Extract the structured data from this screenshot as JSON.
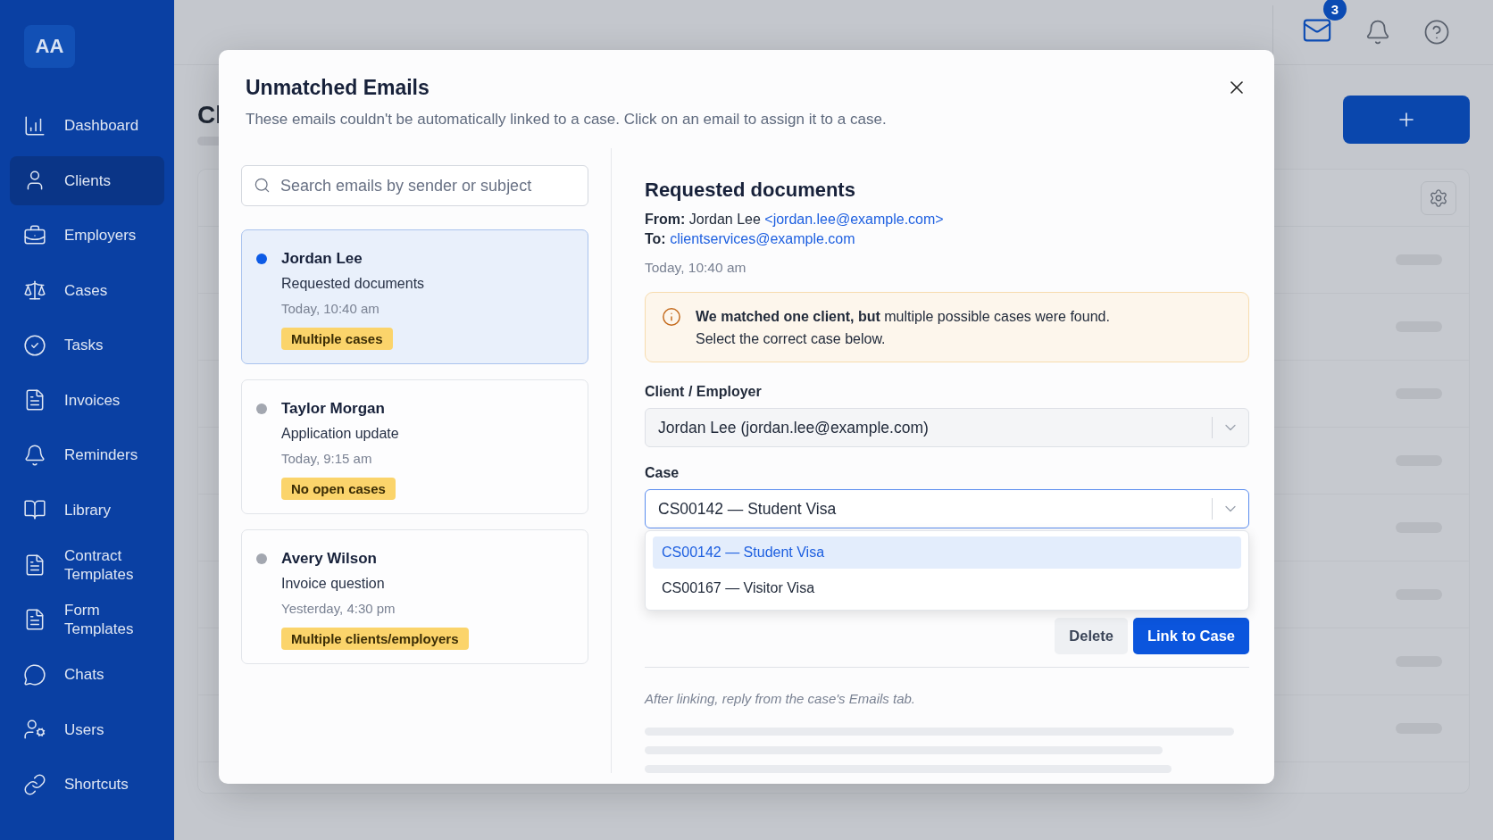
{
  "sidebar": {
    "logo": "AA",
    "items": [
      {
        "label": "Dashboard",
        "selected": false
      },
      {
        "label": "Clients",
        "selected": true
      },
      {
        "label": "Employers",
        "selected": false
      },
      {
        "label": "Cases",
        "selected": false
      },
      {
        "label": "Tasks",
        "selected": false
      },
      {
        "label": "Invoices",
        "selected": false
      },
      {
        "label": "Reminders",
        "selected": false
      },
      {
        "label": "Library",
        "selected": false
      },
      {
        "label": "Contract Templates",
        "selected": false
      },
      {
        "label": "Form Templates",
        "selected": false
      },
      {
        "label": "Chats",
        "selected": false
      },
      {
        "label": "Users",
        "selected": false
      },
      {
        "label": "Shortcuts",
        "selected": false
      }
    ]
  },
  "topbar": {
    "mail_badge": "3"
  },
  "page": {
    "title": "Cl"
  },
  "modal": {
    "title": "Unmatched Emails",
    "subtitle": "These emails couldn't be automatically linked to a case. Click on an email to assign it to a case.",
    "search": {
      "placeholder": "Search emails by sender or subject"
    },
    "emails": [
      {
        "sender": "Jordan Lee",
        "subject": "Requested documents",
        "time": "Today, 10:40 am",
        "tag": "Multiple cases",
        "selected": true
      },
      {
        "sender": "Taylor Morgan",
        "subject": "Application update",
        "time": "Today, 9:15 am",
        "tag": "No open cases",
        "selected": false
      },
      {
        "sender": "Avery Wilson",
        "subject": "Invoice question",
        "time": "Yesterday, 4:30 pm",
        "tag": "Multiple clients/employers",
        "selected": false
      }
    ],
    "detail": {
      "subject": "Requested documents",
      "from_label": "From:",
      "from_name": "Jordan Lee",
      "from_email": "<jordan.lee@example.com>",
      "to_label": "To:",
      "to_email": "clientservices@example.com",
      "time": "Today, 10:40 am",
      "notice": [
        "**We matched one client, but** multiple possible cases were found.",
        "Select the correct case below."
      ],
      "fields": [
        {
          "label": "Client / Employer",
          "value": "Jordan Lee (jordan.lee@example.com)",
          "focused": false
        },
        {
          "label": "Case",
          "value": "CS00142 — Student Visa",
          "focused": true,
          "open": true,
          "options": [
            {
              "label": "CS00142 — Student Visa",
              "selected": true
            },
            {
              "label": "CS00167 — Visitor Visa",
              "selected": false
            }
          ]
        }
      ],
      "buttons": [
        {
          "label": "Delete",
          "kind": "secondary"
        },
        {
          "label": "Link to Case",
          "kind": "primary"
        }
      ],
      "note": "After linking, reply from the case's Emails tab."
    }
  }
}
